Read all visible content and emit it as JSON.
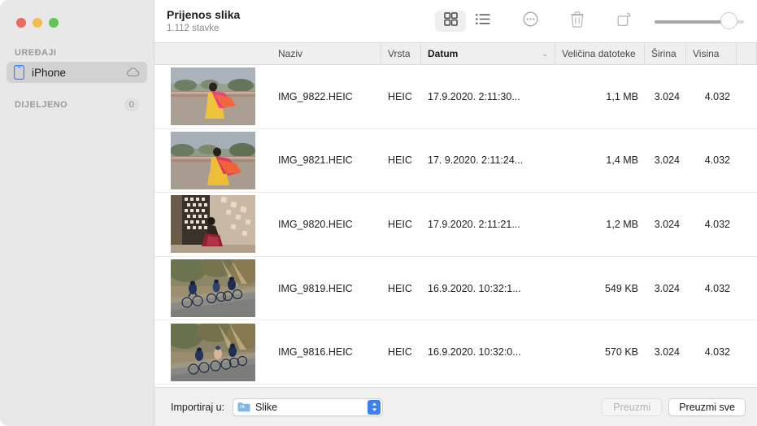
{
  "window": {
    "title": "Prijenos slika",
    "subtitle": "1.112 stavke",
    "traffic_lights": {
      "close_color": "#ed6a5e",
      "minimize_color": "#f4bd4f",
      "maximize_color": "#61c454"
    }
  },
  "sidebar": {
    "sections": [
      {
        "header": "UREĐAJI",
        "badge": "",
        "items": [
          {
            "label": "iPhone",
            "icon": "iphone-icon",
            "trailing_icon": "cloud-icon",
            "selected": true
          }
        ]
      },
      {
        "header": "DIJELJENO",
        "badge": "0",
        "items": []
      }
    ]
  },
  "toolbar": {
    "buttons": [
      {
        "name": "grid-view-button",
        "icon": "grid-icon",
        "selected": true
      },
      {
        "name": "list-view-button",
        "icon": "list-icon",
        "selected": false
      },
      {
        "name": "more-options-button",
        "icon": "ellipsis-circle-icon",
        "selected": false
      },
      {
        "name": "delete-button",
        "icon": "trash-icon",
        "selected": false
      },
      {
        "name": "rotate-button",
        "icon": "rotate-icon",
        "selected": false
      }
    ],
    "slider": {
      "name": "thumbnail-size-slider",
      "value": 78
    }
  },
  "table": {
    "columns": [
      {
        "key": "thumbnail",
        "label": "",
        "align": "left"
      },
      {
        "key": "name",
        "label": "Naziv",
        "align": "left",
        "sorted": false
      },
      {
        "key": "kind",
        "label": "Vrsta",
        "align": "left",
        "sorted": false
      },
      {
        "key": "date",
        "label": "Datum",
        "align": "left",
        "sorted": true,
        "sort_indicator": "⌄"
      },
      {
        "key": "size",
        "label": "Veličina datoteke",
        "align": "right",
        "sorted": false
      },
      {
        "key": "width",
        "label": "Širina",
        "align": "right",
        "sorted": false
      },
      {
        "key": "height",
        "label": "Visina",
        "align": "right",
        "sorted": false
      }
    ],
    "rows": [
      {
        "name": "IMG_9822.HEIC",
        "kind": "HEIC",
        "date": "17.9.2020. 2:11:30...",
        "size": "1,1 MB",
        "width": "3.024",
        "height": "4.032",
        "thumbnail": "woman-pink-sari-terrace"
      },
      {
        "name": "IMG_9821.HEIC",
        "kind": "HEIC",
        "date": "17. 9.2020. 2:11:24...",
        "size": "1,4 MB",
        "width": "3.024",
        "height": "4.032",
        "thumbnail": "woman-pink-sari-terrace-2"
      },
      {
        "name": "IMG_9820.HEIC",
        "kind": "HEIC",
        "date": "17.9.2020. 2:11:21...",
        "size": "1,2 MB",
        "width": "3.024",
        "height": "4.032",
        "thumbnail": "woman-red-sari-lattice-window"
      },
      {
        "name": "IMG_9819.HEIC",
        "kind": "HEIC",
        "date": "16.9.2020. 10:32:1...",
        "size": "549 KB",
        "width": "3.024",
        "height": "4.032",
        "thumbnail": "cyclists-misty-road"
      },
      {
        "name": "IMG_9816.HEIC",
        "kind": "HEIC",
        "date": "16.9.2020. 10:32:0...",
        "size": "570 KB",
        "width": "3.024",
        "height": "4.032",
        "thumbnail": "cyclists-misty-road-2"
      }
    ]
  },
  "bottom_bar": {
    "import_label": "Importiraj u:",
    "destination": {
      "value": "Slike",
      "icon": "pictures-folder-icon"
    },
    "download_button": {
      "label": "Preuzmi",
      "enabled": false
    },
    "download_all_button": {
      "label": "Preuzmi sve",
      "enabled": true
    }
  }
}
